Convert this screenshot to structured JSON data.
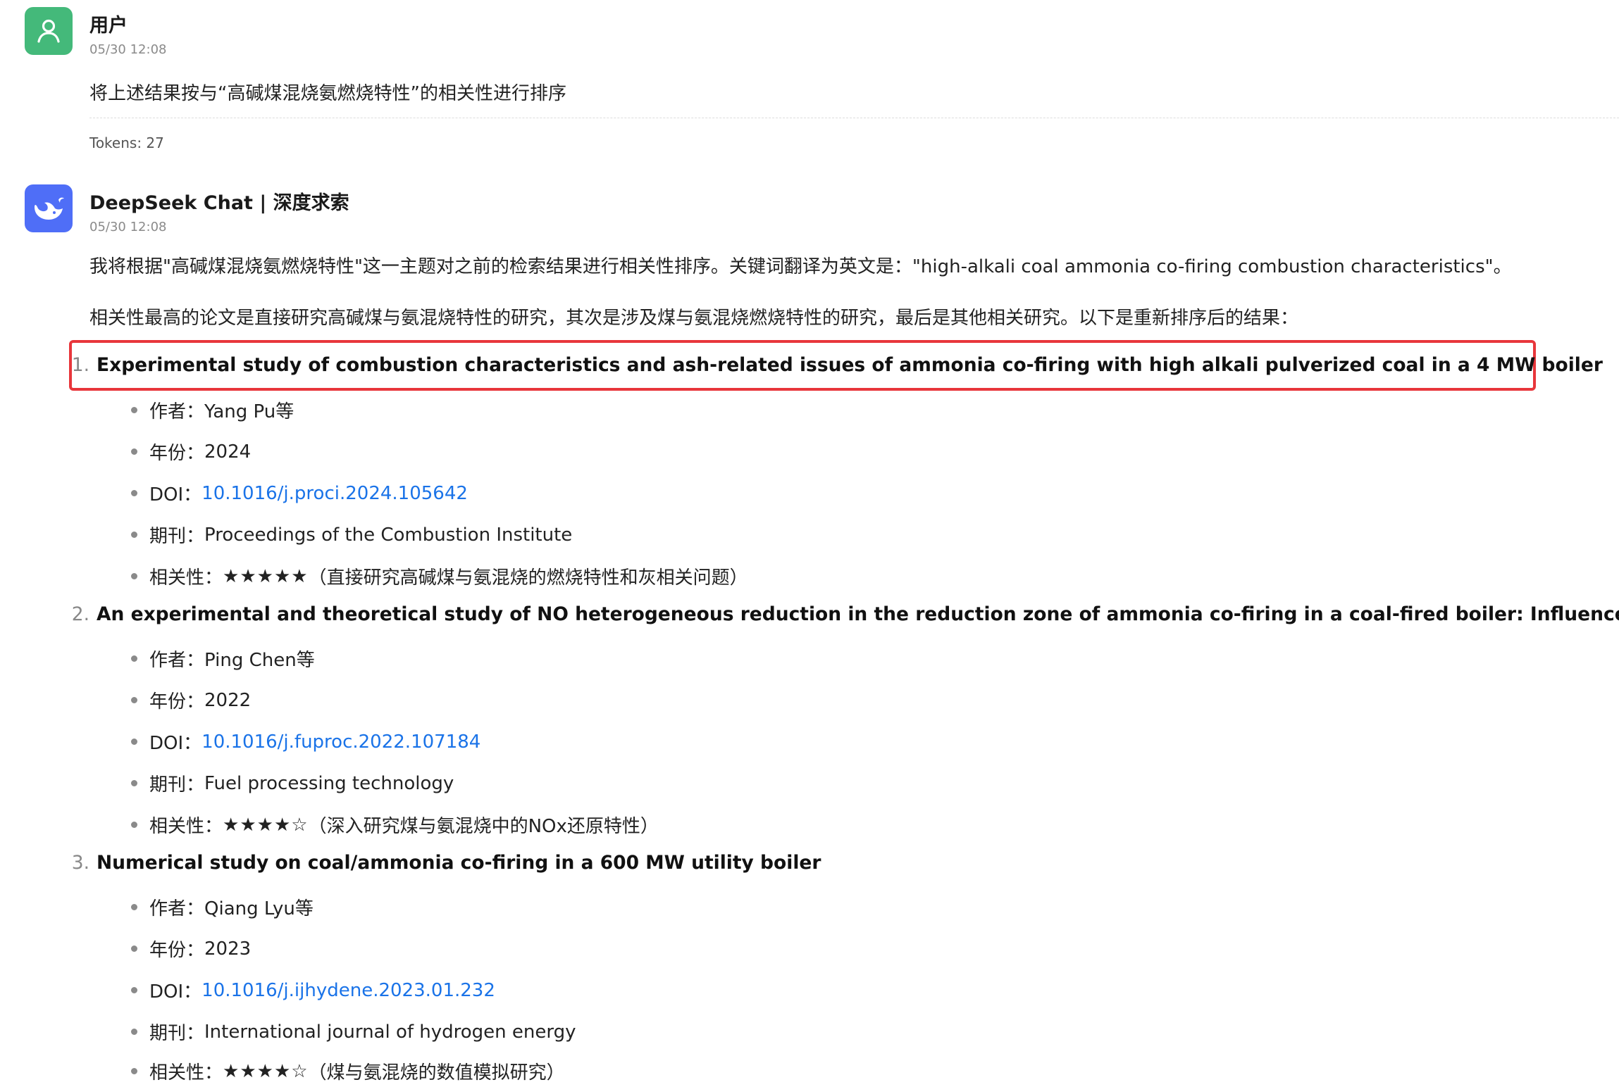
{
  "user_message": {
    "name": "用户",
    "time": "05/30 12:08",
    "text": "将上述结果按与“高碱煤混烧氨燃烧特性”的相关性进行排序",
    "tokens": "Tokens: 27"
  },
  "bot_message": {
    "name": "DeepSeek Chat | 深度求索",
    "time": "05/30 12:08",
    "paragraph1": "我将根据\"高碱煤混烧氨燃烧特性\"这一主题对之前的检索结果进行相关性排序。关键词翻译为英文是：\"high-alkali coal ammonia co-firing combustion characteristics\"。",
    "paragraph2": "相关性最高的论文是直接研究高碱煤与氨混烧特性的研究，其次是涉及煤与氨混烧燃烧特性的研究，最后是其他相关研究。以下是重新排序后的结果：",
    "labels": {
      "author": "作者：",
      "year": "年份：",
      "doi": "DOI：",
      "journal": "期刊：",
      "relevance": "相关性："
    },
    "items": [
      {
        "num": "1.",
        "title": "Experimental study of combustion characteristics and ash-related issues of ammonia co-firing with high alkali pulverized coal in a 4 MW boiler",
        "author": "Yang Pu等",
        "year": "2024",
        "doi": "10.1016/j.proci.2024.105642",
        "journal": "Proceedings of the Combustion Institute",
        "relevance_stars": "★★★★★",
        "relevance_note": "（直接研究高碱煤与氨混烧的燃烧特性和灰相关问题）"
      },
      {
        "num": "2.",
        "title": "An experimental and theoretical study of NO heterogeneous reduction in the reduction zone of ammonia co-firing in a coal-fired boiler: Influence of CO",
        "author": "Ping Chen等",
        "year": "2022",
        "doi": "10.1016/j.fuproc.2022.107184",
        "journal": "Fuel processing technology",
        "relevance_stars": "★★★★☆",
        "relevance_note": "（深入研究煤与氨混烧中的NOx还原特性）"
      },
      {
        "num": "3.",
        "title": "Numerical study on coal/ammonia co-firing in a 600 MW utility boiler",
        "author": "Qiang Lyu等",
        "year": "2023",
        "doi": "10.1016/j.ijhydene.2023.01.232",
        "journal": "International journal of hydrogen energy",
        "relevance_stars": "★★★★☆",
        "relevance_note": "（煤与氨混烧的数值模拟研究）"
      }
    ]
  },
  "colors": {
    "user_avatar": "#44b97a",
    "bot_avatar": "#4f6ef7",
    "link": "#1a73e8",
    "highlight_border": "#e8363b"
  },
  "icons": {
    "user_avatar": "user-icon",
    "bot_avatar": "whale-icon"
  }
}
